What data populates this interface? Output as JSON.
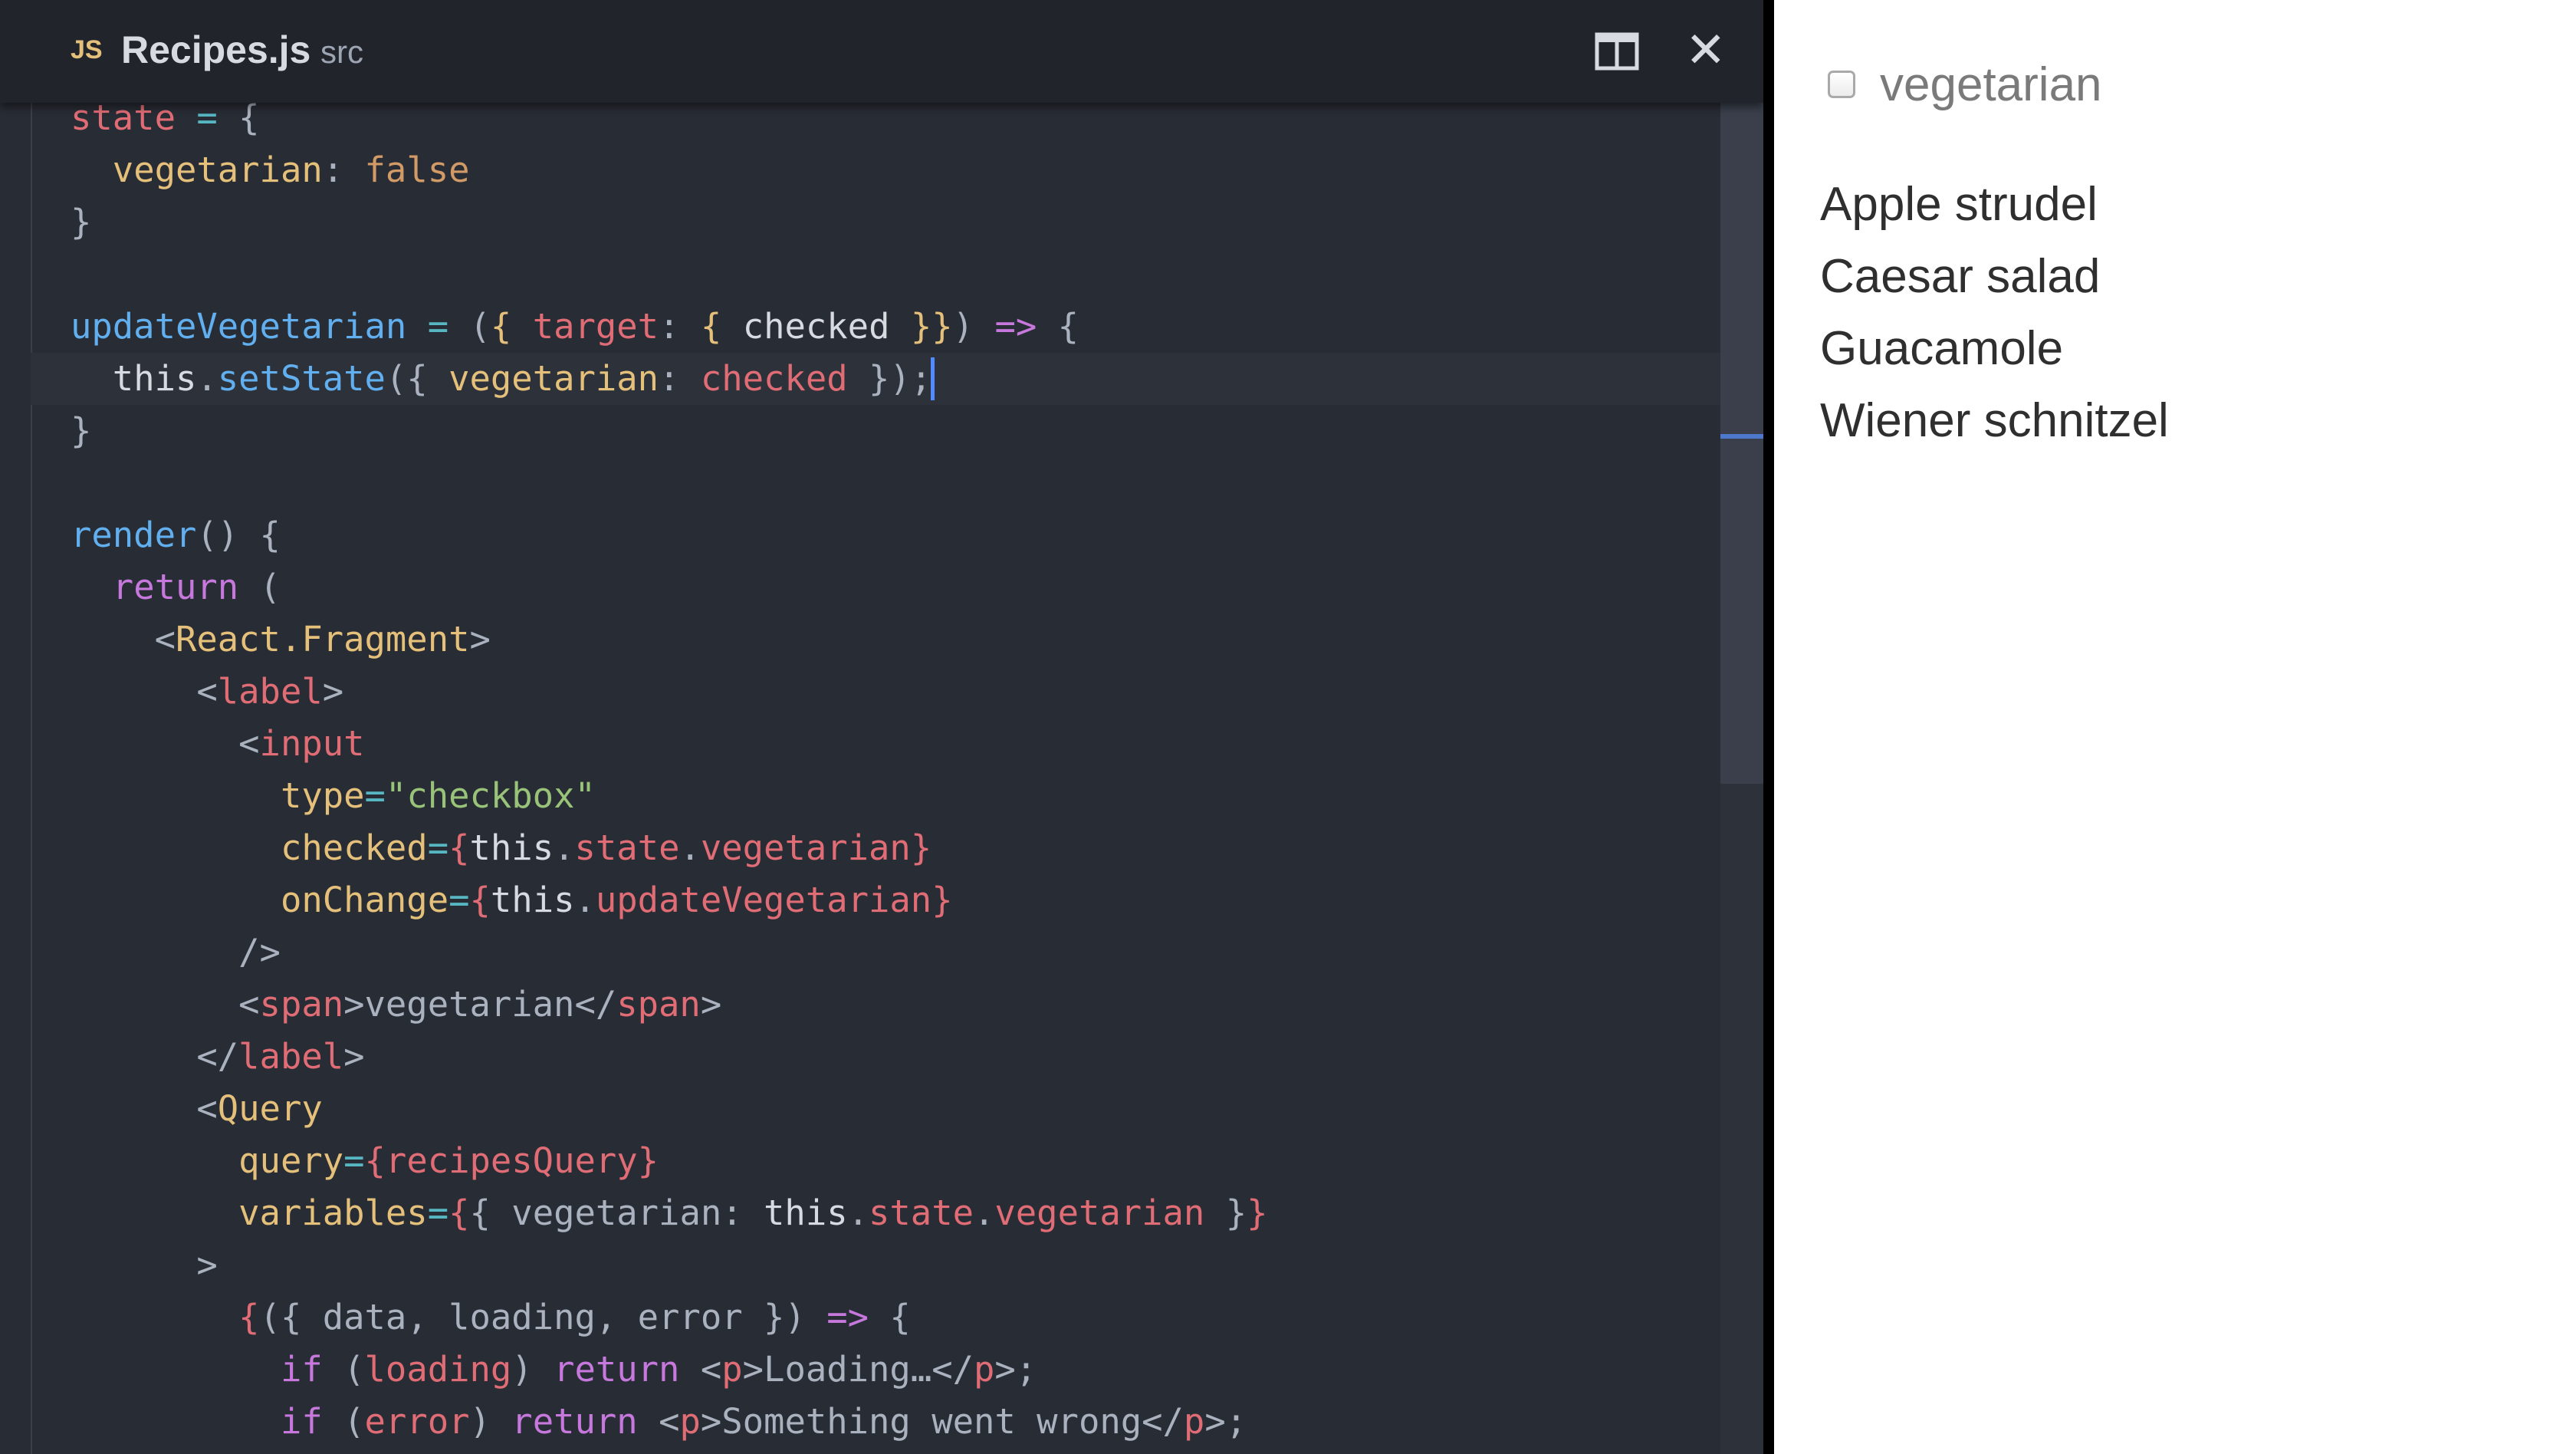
{
  "editor": {
    "tab": {
      "type_badge": "JS",
      "file_name": "Recipes.js",
      "folder": "src",
      "split_icon": "split-editor-icon",
      "close_icon": "close-icon",
      "close_glyph": "✕"
    },
    "cursor_line": 6,
    "code_lines": [
      [
        [
          "c-red",
          "state"
        ],
        [
          "c-plain",
          " "
        ],
        [
          "c-cyan",
          "="
        ],
        [
          "c-plain",
          " {"
        ]
      ],
      [
        [
          "c-plain",
          "  "
        ],
        [
          "c-yellow",
          "vegetarian"
        ],
        [
          "c-plain",
          ": "
        ],
        [
          "c-orange",
          "false"
        ]
      ],
      [
        [
          "c-plain",
          "}"
        ]
      ],
      [
        [
          "c-plain",
          ""
        ]
      ],
      [
        [
          "c-blue",
          "updateVegetarian"
        ],
        [
          "c-plain",
          " "
        ],
        [
          "c-cyan",
          "="
        ],
        [
          "c-plain",
          " ("
        ],
        [
          "c-yellow",
          "{"
        ],
        [
          "c-plain",
          " "
        ],
        [
          "c-red",
          "target"
        ],
        [
          "c-plain",
          ": "
        ],
        [
          "c-yellow",
          "{"
        ],
        [
          "c-plain",
          " "
        ],
        [
          "c-white",
          "checked"
        ],
        [
          "c-plain",
          " "
        ],
        [
          "c-yellow",
          "}}"
        ],
        [
          "c-plain",
          ") "
        ],
        [
          "c-purple",
          "=>"
        ],
        [
          "c-plain",
          " {"
        ]
      ],
      [
        [
          "c-plain",
          "  "
        ],
        [
          "c-white",
          "this"
        ],
        [
          "c-plain",
          "."
        ],
        [
          "c-blue",
          "setState"
        ],
        [
          "c-plain",
          "({ "
        ],
        [
          "c-yellow",
          "vegetarian"
        ],
        [
          "c-plain",
          ": "
        ],
        [
          "c-red",
          "checked"
        ],
        [
          "c-plain",
          " });"
        ]
      ],
      [
        [
          "c-plain",
          "}"
        ]
      ],
      [
        [
          "c-plain",
          ""
        ]
      ],
      [
        [
          "c-blue",
          "render"
        ],
        [
          "c-plain",
          "() {"
        ]
      ],
      [
        [
          "c-plain",
          "  "
        ],
        [
          "c-purple",
          "return"
        ],
        [
          "c-plain",
          " ("
        ]
      ],
      [
        [
          "c-plain",
          "    <"
        ],
        [
          "c-yellow",
          "React.Fragment"
        ],
        [
          "c-plain",
          ">"
        ]
      ],
      [
        [
          "c-plain",
          "      <"
        ],
        [
          "c-red",
          "label"
        ],
        [
          "c-plain",
          ">"
        ]
      ],
      [
        [
          "c-plain",
          "        <"
        ],
        [
          "c-red",
          "input"
        ]
      ],
      [
        [
          "c-plain",
          "          "
        ],
        [
          "c-yellow",
          "type"
        ],
        [
          "c-cyan",
          "="
        ],
        [
          "c-green",
          "\"checkbox\""
        ]
      ],
      [
        [
          "c-plain",
          "          "
        ],
        [
          "c-yellow",
          "checked"
        ],
        [
          "c-cyan",
          "="
        ],
        [
          "c-red",
          "{"
        ],
        [
          "c-white",
          "this"
        ],
        [
          "c-plain",
          "."
        ],
        [
          "c-red",
          "state"
        ],
        [
          "c-plain",
          "."
        ],
        [
          "c-red",
          "vegetarian"
        ],
        [
          "c-red",
          "}"
        ]
      ],
      [
        [
          "c-plain",
          "          "
        ],
        [
          "c-yellow",
          "onChange"
        ],
        [
          "c-cyan",
          "="
        ],
        [
          "c-red",
          "{"
        ],
        [
          "c-white",
          "this"
        ],
        [
          "c-plain",
          "."
        ],
        [
          "c-red",
          "updateVegetarian"
        ],
        [
          "c-red",
          "}"
        ]
      ],
      [
        [
          "c-plain",
          "        />"
        ]
      ],
      [
        [
          "c-plain",
          "        <"
        ],
        [
          "c-red",
          "span"
        ],
        [
          "c-plain",
          ">vegetarian</"
        ],
        [
          "c-red",
          "span"
        ],
        [
          "c-plain",
          ">"
        ]
      ],
      [
        [
          "c-plain",
          "      </"
        ],
        [
          "c-red",
          "label"
        ],
        [
          "c-plain",
          ">"
        ]
      ],
      [
        [
          "c-plain",
          "      <"
        ],
        [
          "c-yellow",
          "Query"
        ]
      ],
      [
        [
          "c-plain",
          "        "
        ],
        [
          "c-yellow",
          "query"
        ],
        [
          "c-cyan",
          "="
        ],
        [
          "c-red",
          "{recipesQuery}"
        ]
      ],
      [
        [
          "c-plain",
          "        "
        ],
        [
          "c-yellow",
          "variables"
        ],
        [
          "c-cyan",
          "="
        ],
        [
          "c-red",
          "{"
        ],
        [
          "c-plain",
          "{ vegetarian: "
        ],
        [
          "c-white",
          "this"
        ],
        [
          "c-plain",
          "."
        ],
        [
          "c-red",
          "state"
        ],
        [
          "c-plain",
          "."
        ],
        [
          "c-red",
          "vegetarian"
        ],
        [
          "c-plain",
          " }"
        ],
        [
          "c-red",
          "}"
        ]
      ],
      [
        [
          "c-plain",
          "      >"
        ]
      ],
      [
        [
          "c-plain",
          "        "
        ],
        [
          "c-red",
          "{"
        ],
        [
          "c-plain",
          "({ data, loading, error }) "
        ],
        [
          "c-purple",
          "=>"
        ],
        [
          "c-plain",
          " {"
        ]
      ],
      [
        [
          "c-plain",
          "          "
        ],
        [
          "c-purple",
          "if"
        ],
        [
          "c-plain",
          " ("
        ],
        [
          "c-red",
          "loading"
        ],
        [
          "c-plain",
          ") "
        ],
        [
          "c-purple",
          "return"
        ],
        [
          "c-plain",
          " <"
        ],
        [
          "c-red",
          "p"
        ],
        [
          "c-plain",
          ">Loading…</"
        ],
        [
          "c-red",
          "p"
        ],
        [
          "c-plain",
          ">;"
        ]
      ],
      [
        [
          "c-plain",
          "          "
        ],
        [
          "c-purple",
          "if"
        ],
        [
          "c-plain",
          " ("
        ],
        [
          "c-red",
          "error"
        ],
        [
          "c-plain",
          ") "
        ],
        [
          "c-purple",
          "return"
        ],
        [
          "c-plain",
          " <"
        ],
        [
          "c-red",
          "p"
        ],
        [
          "c-plain",
          ">Something went wrong</"
        ],
        [
          "c-red",
          "p"
        ],
        [
          "c-plain",
          ">;"
        ]
      ]
    ]
  },
  "preview": {
    "checkbox_label": "vegetarian",
    "checkbox_checked": false,
    "recipes": [
      "Apple strudel",
      "Caesar salad",
      "Guacamole",
      "Wiener schnitzel"
    ]
  },
  "colors": {
    "editor_bg": "#282c34",
    "tab_bg": "#21252b",
    "cursor": "#528bff",
    "preview_bg": "#ffffff"
  }
}
